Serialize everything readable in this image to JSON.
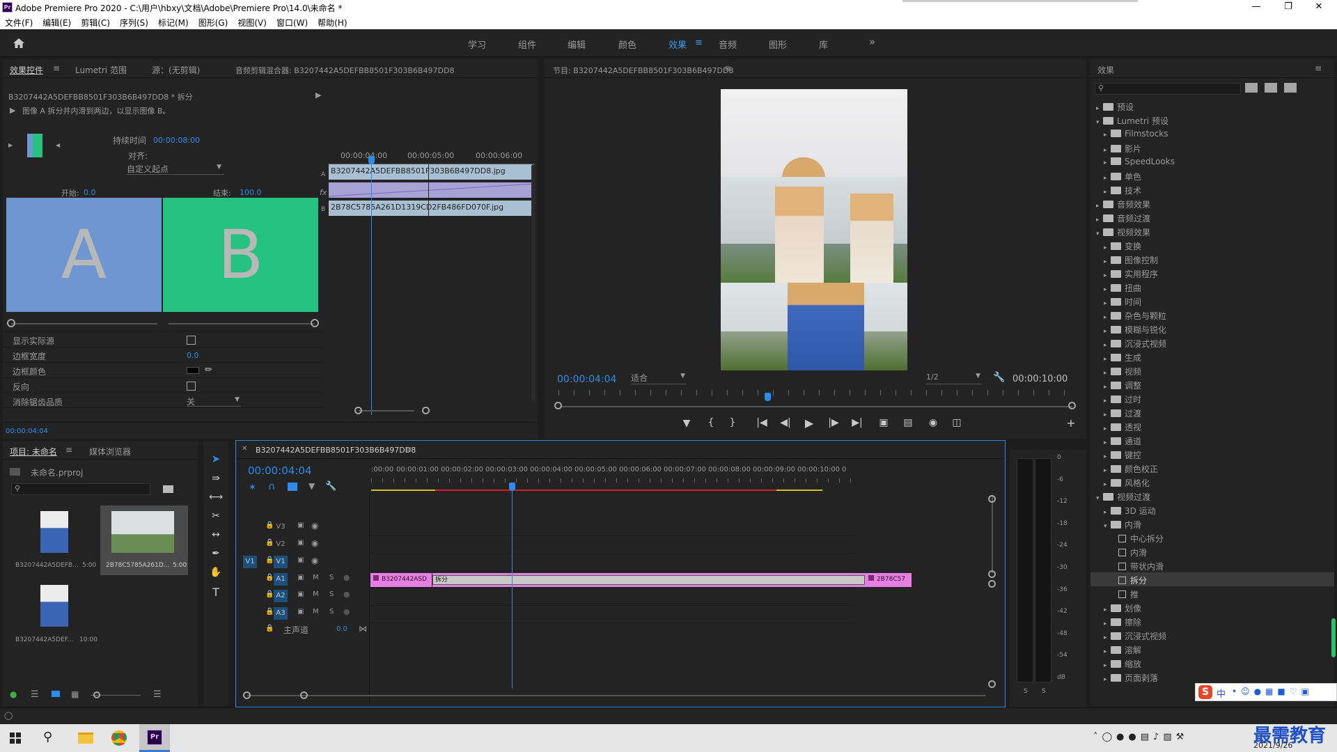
{
  "app": {
    "title": "Adobe Premiere Pro 2020 - C:\\用户\\hbxy\\文档\\Adobe\\Premiere Pro\\14.0\\未命名 *",
    "logo_text": "Pr"
  },
  "menu": [
    "文件(F)",
    "编辑(E)",
    "剪辑(C)",
    "序列(S)",
    "标记(M)",
    "图形(G)",
    "视图(V)",
    "窗口(W)",
    "帮助(H)"
  ],
  "workspaces": [
    "学习",
    "组件",
    "编辑",
    "颜色",
    "效果",
    "音频",
    "图形",
    "库"
  ],
  "active_workspace": "效果",
  "effect_controls": {
    "tabs": [
      "效果控件",
      "Lumetri 范围",
      "源：(无剪辑)",
      "音频剪辑混合器: B3207442A5DEFBB8501F303B6B497DD8"
    ],
    "clip_label": "B3207442A5DEFBB8501F303B6B497DD8 * 拆分",
    "description": "图像 A 拆分并内滑到两边，以显示图像 B。",
    "duration_label": "持续时间",
    "duration_value": "00:00:08:00",
    "align_label": "对齐:",
    "align_value": "自定义起点",
    "start_label": "开始:",
    "start_value": "0.0",
    "end_label": "结束:",
    "end_value": "100.0",
    "preview_a": "A",
    "preview_b": "B",
    "color_a": "#6e97d2",
    "color_b": "#26c281",
    "props": [
      {
        "label": "显示实际源",
        "kind": "checkbox"
      },
      {
        "label": "边框宽度",
        "kind": "value",
        "value": "0.0"
      },
      {
        "label": "边框颜色",
        "kind": "color"
      },
      {
        "label": "反向",
        "kind": "checkbox"
      },
      {
        "label": "消除锯齿品质",
        "kind": "select",
        "value": "关"
      }
    ],
    "timecode": "00:00:04:04",
    "mini_ruler": [
      "00:00:04:00",
      "00:00:05:00",
      "00:00:06:00"
    ],
    "clip_a": "B3207442A5DEFBB8501F303B6B497DD8.jpg",
    "clip_b": "2B78C5785A261D1319CD2FB486FD070F.jpg",
    "track_letters": [
      "A",
      "fx",
      "B"
    ]
  },
  "program": {
    "title": "节目: B3207442A5DEFBB8501F303B6B497DD8",
    "timecode": "00:00:04:04",
    "fit": "适合",
    "resolution": "1/2",
    "duration": "00:00:10:00"
  },
  "effects_panel": {
    "title": "效果",
    "tree": [
      {
        "label": "预设",
        "level": 0,
        "open": false,
        "type": "folder"
      },
      {
        "label": "Lumetri 预设",
        "level": 0,
        "open": true,
        "type": "folder"
      },
      {
        "label": "Filmstocks",
        "level": 1,
        "open": false,
        "type": "folder"
      },
      {
        "label": "影片",
        "level": 1,
        "open": false,
        "type": "folder"
      },
      {
        "label": "SpeedLooks",
        "level": 1,
        "open": false,
        "type": "folder"
      },
      {
        "label": "单色",
        "level": 1,
        "open": false,
        "type": "folder"
      },
      {
        "label": "技术",
        "level": 1,
        "open": false,
        "type": "folder"
      },
      {
        "label": "音频效果",
        "level": 0,
        "open": false,
        "type": "folder"
      },
      {
        "label": "音频过渡",
        "level": 0,
        "open": false,
        "type": "folder"
      },
      {
        "label": "视频效果",
        "level": 0,
        "open": true,
        "type": "folder"
      },
      {
        "label": "变换",
        "level": 1,
        "open": false,
        "type": "folder"
      },
      {
        "label": "图像控制",
        "level": 1,
        "open": false,
        "type": "folder"
      },
      {
        "label": "实用程序",
        "level": 1,
        "open": false,
        "type": "folder"
      },
      {
        "label": "扭曲",
        "level": 1,
        "open": false,
        "type": "folder"
      },
      {
        "label": "时间",
        "level": 1,
        "open": false,
        "type": "folder"
      },
      {
        "label": "杂色与颗粒",
        "level": 1,
        "open": false,
        "type": "folder"
      },
      {
        "label": "模糊与锐化",
        "level": 1,
        "open": false,
        "type": "folder"
      },
      {
        "label": "沉浸式视频",
        "level": 1,
        "open": false,
        "type": "folder"
      },
      {
        "label": "生成",
        "level": 1,
        "open": false,
        "type": "folder"
      },
      {
        "label": "视频",
        "level": 1,
        "open": false,
        "type": "folder"
      },
      {
        "label": "调整",
        "level": 1,
        "open": false,
        "type": "folder"
      },
      {
        "label": "过时",
        "level": 1,
        "open": false,
        "type": "folder"
      },
      {
        "label": "过渡",
        "level": 1,
        "open": false,
        "type": "folder"
      },
      {
        "label": "透视",
        "level": 1,
        "open": false,
        "type": "folder"
      },
      {
        "label": "通道",
        "level": 1,
        "open": false,
        "type": "folder"
      },
      {
        "label": "键控",
        "level": 1,
        "open": false,
        "type": "folder"
      },
      {
        "label": "颜色校正",
        "level": 1,
        "open": false,
        "type": "folder"
      },
      {
        "label": "风格化",
        "level": 1,
        "open": false,
        "type": "folder"
      },
      {
        "label": "视频过渡",
        "level": 0,
        "open": true,
        "type": "folder"
      },
      {
        "label": "3D 运动",
        "level": 1,
        "open": false,
        "type": "folder"
      },
      {
        "label": "内滑",
        "level": 1,
        "open": true,
        "type": "folder"
      },
      {
        "label": "中心拆分",
        "level": 2,
        "type": "effect"
      },
      {
        "label": "内滑",
        "level": 2,
        "type": "effect"
      },
      {
        "label": "带状内滑",
        "level": 2,
        "type": "effect"
      },
      {
        "label": "拆分",
        "level": 2,
        "type": "effect",
        "selected": true
      },
      {
        "label": "推",
        "level": 2,
        "type": "effect"
      },
      {
        "label": "划像",
        "level": 1,
        "open": false,
        "type": "folder"
      },
      {
        "label": "擦除",
        "level": 1,
        "open": false,
        "type": "folder"
      },
      {
        "label": "沉浸式视频",
        "level": 1,
        "open": false,
        "type": "folder"
      },
      {
        "label": "溶解",
        "level": 1,
        "open": false,
        "type": "folder"
      },
      {
        "label": "缩放",
        "level": 1,
        "open": false,
        "type": "folder"
      },
      {
        "label": "页面剥落",
        "level": 1,
        "open": false,
        "type": "folder"
      }
    ]
  },
  "project": {
    "tabs": [
      "项目: 未命名",
      "媒体浏览器"
    ],
    "file": "未命名.prproj",
    "items": [
      {
        "name": "B3207442A5DEFB...",
        "dur": "5:00"
      },
      {
        "name": "2B78C5785A261D...",
        "dur": "5:00"
      },
      {
        "name": "B3207442A5DEF...",
        "dur": "10:00"
      }
    ]
  },
  "timeline": {
    "title": "B3207442A5DEFBB8501F303B6B497DD8",
    "timecode": "00:00:04:04",
    "ruler": [
      ":00:00",
      "00:00:01:00",
      "00:00:02:00",
      "00:00:03:00",
      "00:00:04:00",
      "00:00:05:00",
      "00:00:06:00",
      "00:00:07:00",
      "00:00:08:00",
      "00:00:09:00",
      "00:00:10:00",
      "0"
    ],
    "video_tracks": [
      "V3",
      "V2",
      "V1"
    ],
    "audio_tracks": [
      "A1",
      "A2",
      "A3"
    ],
    "source_patch": "V1",
    "master_label": "主声道",
    "master_value": "0.0",
    "m": "M",
    "s": "S",
    "clip1": "B3207442ASD",
    "transition": "拆分",
    "clip2": "2B78C57"
  },
  "meter": {
    "labels": [
      "0",
      "-6",
      "-12",
      "-18",
      "-24",
      "-30",
      "-36",
      "-42",
      "-48",
      "-54",
      "dB"
    ],
    "s": "S"
  },
  "taskbar": {
    "date": "2021/9/26",
    "watermark": "最需教育",
    "ime": "中"
  }
}
